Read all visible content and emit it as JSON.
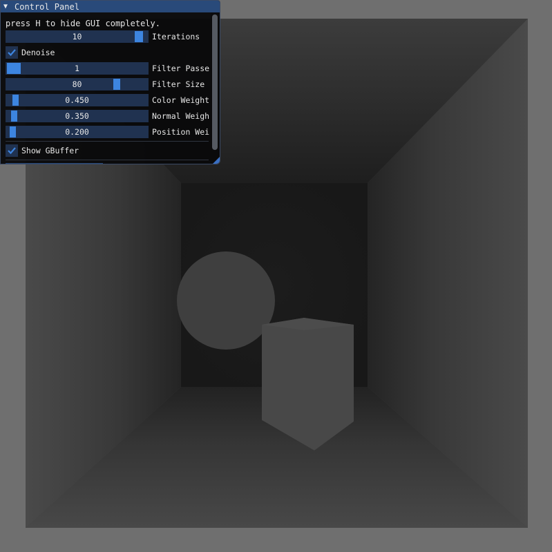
{
  "window": {
    "title": "Control Panel",
    "collapse_icon": "triangle-down-icon"
  },
  "panel": {
    "hint": "press H to hide GUI completely.",
    "sliders": [
      {
        "id": "iterations",
        "label": "Iterations",
        "value": "10",
        "fraction": 0.97
      },
      {
        "id": "filter-passes",
        "label": "Filter Passe",
        "value": "1",
        "fraction": 0.0
      },
      {
        "id": "filter-size",
        "label": "Filter Size",
        "value": "80",
        "fraction": 0.8
      },
      {
        "id": "color-weight",
        "label": "Color Weight",
        "value": "0.450",
        "fraction": 0.04
      },
      {
        "id": "normal-weight",
        "label": "Normal Weigh",
        "value": "0.350",
        "fraction": 0.03
      },
      {
        "id": "position-weight",
        "label": "Position Wei",
        "value": "0.200",
        "fraction": 0.02
      }
    ],
    "checkboxes": [
      {
        "id": "denoise",
        "label": "Denoise",
        "checked": true
      },
      {
        "id": "show-gbuffer",
        "label": "Show GBuffer",
        "checked": true
      }
    ]
  },
  "colors": {
    "accent": "#3d85e0",
    "title_bar": "#294a7a",
    "frame_bg": "#203250",
    "scene_background": "#6f6f6f"
  }
}
